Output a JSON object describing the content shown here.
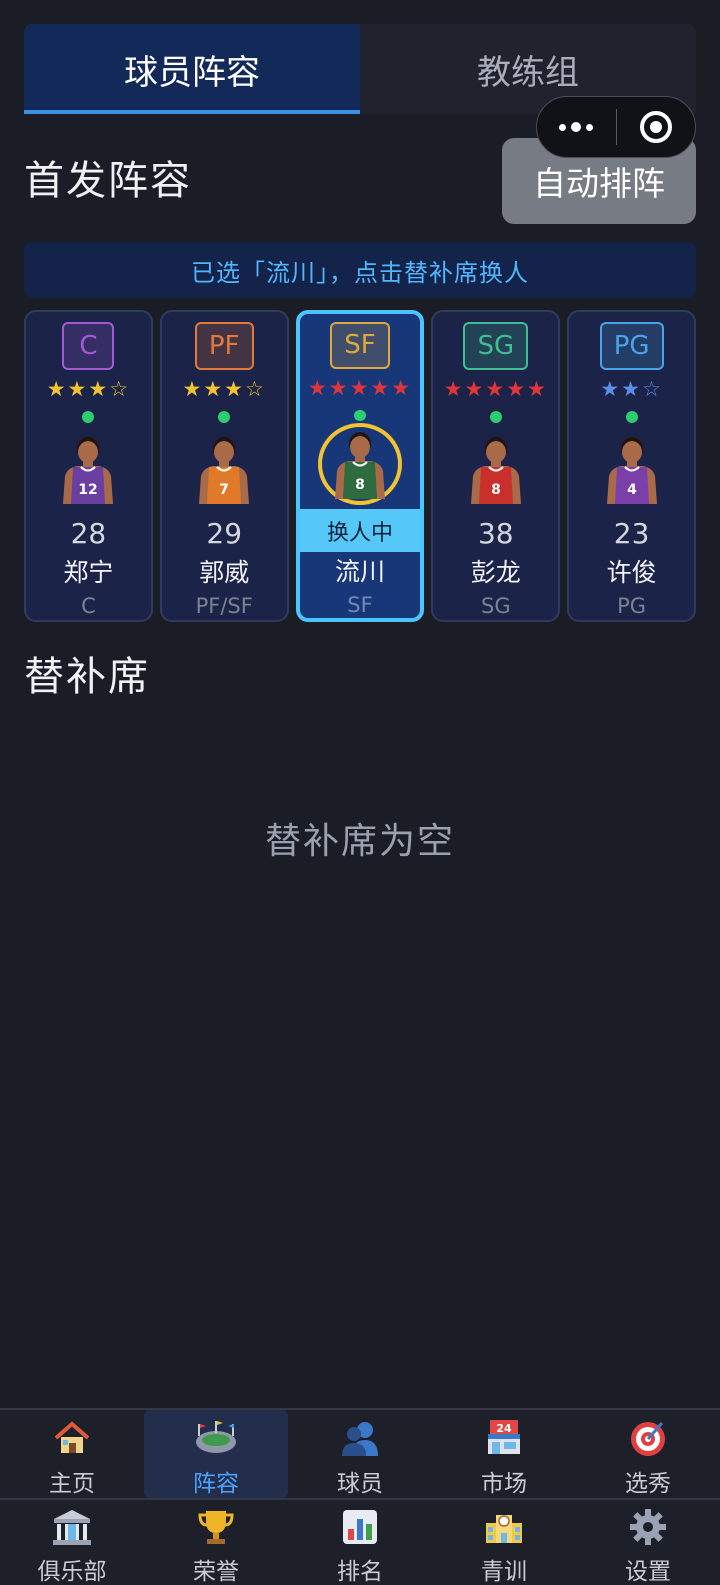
{
  "tabs": [
    {
      "label": "球员阵容",
      "active": true
    },
    {
      "label": "教练组",
      "active": false
    }
  ],
  "capsule": {
    "more_icon": "more-dots-icon",
    "close_icon": "target-close-icon"
  },
  "starting": {
    "title": "首发阵容",
    "auto_button": "自动排阵",
    "notice": "已选「流川」，点击替补席换人"
  },
  "players": [
    {
      "position": "C",
      "stars": "★★★☆",
      "star_color": "#f2c230",
      "age": "28",
      "name": "郑宁",
      "role": "C",
      "badge_color": "#a25bd6",
      "jersey_color": "#6b3fa0",
      "number": "12",
      "selected": false
    },
    {
      "position": "PF",
      "stars": "★★★☆",
      "star_color": "#f2c230",
      "age": "29",
      "name": "郭威",
      "role": "PF/SF",
      "badge_color": "#e0793a",
      "jersey_color": "#e07a2a",
      "number": "7",
      "selected": false
    },
    {
      "position": "SF",
      "stars": "★★★★★",
      "star_color": "#e0353a",
      "age": "",
      "name": "流川",
      "role": "SF",
      "badge_color": "#e0a83a",
      "jersey_color": "#2e6b3f",
      "number": "8",
      "selected": true,
      "swap_label": "换人中"
    },
    {
      "position": "SG",
      "stars": "★★★★★",
      "star_color": "#e0353a",
      "age": "38",
      "name": "彭龙",
      "role": "SG",
      "badge_color": "#3fbf8f",
      "jersey_color": "#c9302c",
      "number": "8",
      "selected": false
    },
    {
      "position": "PG",
      "stars": "★★☆",
      "star_color": "#5b8ee8",
      "age": "23",
      "name": "许俊",
      "role": "PG",
      "badge_color": "#4aa3e8",
      "jersey_color": "#7a3fa8",
      "number": "4",
      "selected": false
    }
  ],
  "bench": {
    "title": "替补席",
    "empty_text": "替补席为空"
  },
  "nav": {
    "row1": [
      {
        "label": "主页",
        "icon": "house-icon",
        "active": false
      },
      {
        "label": "阵容",
        "icon": "stadium-icon",
        "active": true
      },
      {
        "label": "球员",
        "icon": "people-icon",
        "active": false
      },
      {
        "label": "市场",
        "icon": "store-icon",
        "active": false
      },
      {
        "label": "选秀",
        "icon": "target-icon",
        "active": false
      }
    ],
    "row2": [
      {
        "label": "俱乐部",
        "icon": "bank-icon",
        "active": false
      },
      {
        "label": "荣誉",
        "icon": "trophy-icon",
        "active": false
      },
      {
        "label": "排名",
        "icon": "bar-chart-icon",
        "active": false
      },
      {
        "label": "青训",
        "icon": "school-icon",
        "active": false
      },
      {
        "label": "设置",
        "icon": "gear-icon",
        "active": false
      }
    ]
  }
}
